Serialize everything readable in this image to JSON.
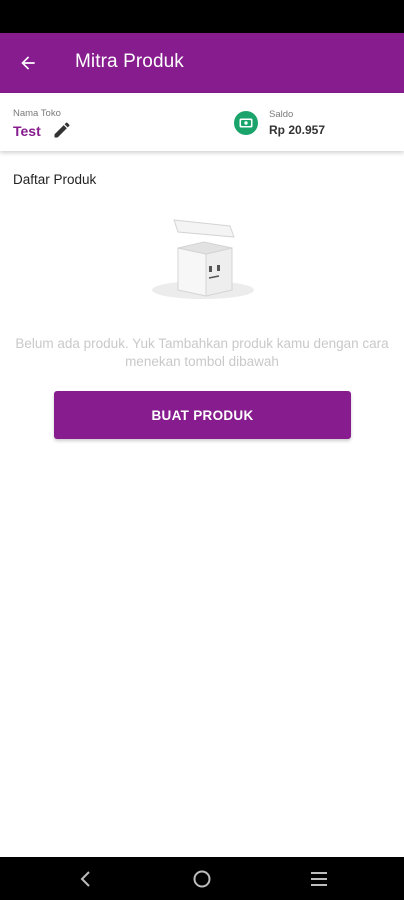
{
  "app_bar": {
    "title": "Mitra Produk",
    "back_icon": "arrow-left-icon",
    "color": "#861c8e"
  },
  "store": {
    "label": "Nama Toko",
    "name": "Test",
    "edit_icon": "pencil-icon"
  },
  "balance": {
    "label": "Saldo",
    "value": "Rp 20.957",
    "icon": "wallet-icon",
    "icon_color": "#1aa36b"
  },
  "products": {
    "section_title": "Daftar Produk",
    "empty_icon": "empty-box-icon",
    "empty_message": "Belum ada produk. Yuk Tambahkan produk kamu dengan cara menekan tombol dibawah",
    "create_button": "BUAT PRODUK"
  },
  "system_nav": {
    "back": "back-icon",
    "home": "home-icon",
    "recents": "menu-icon"
  }
}
